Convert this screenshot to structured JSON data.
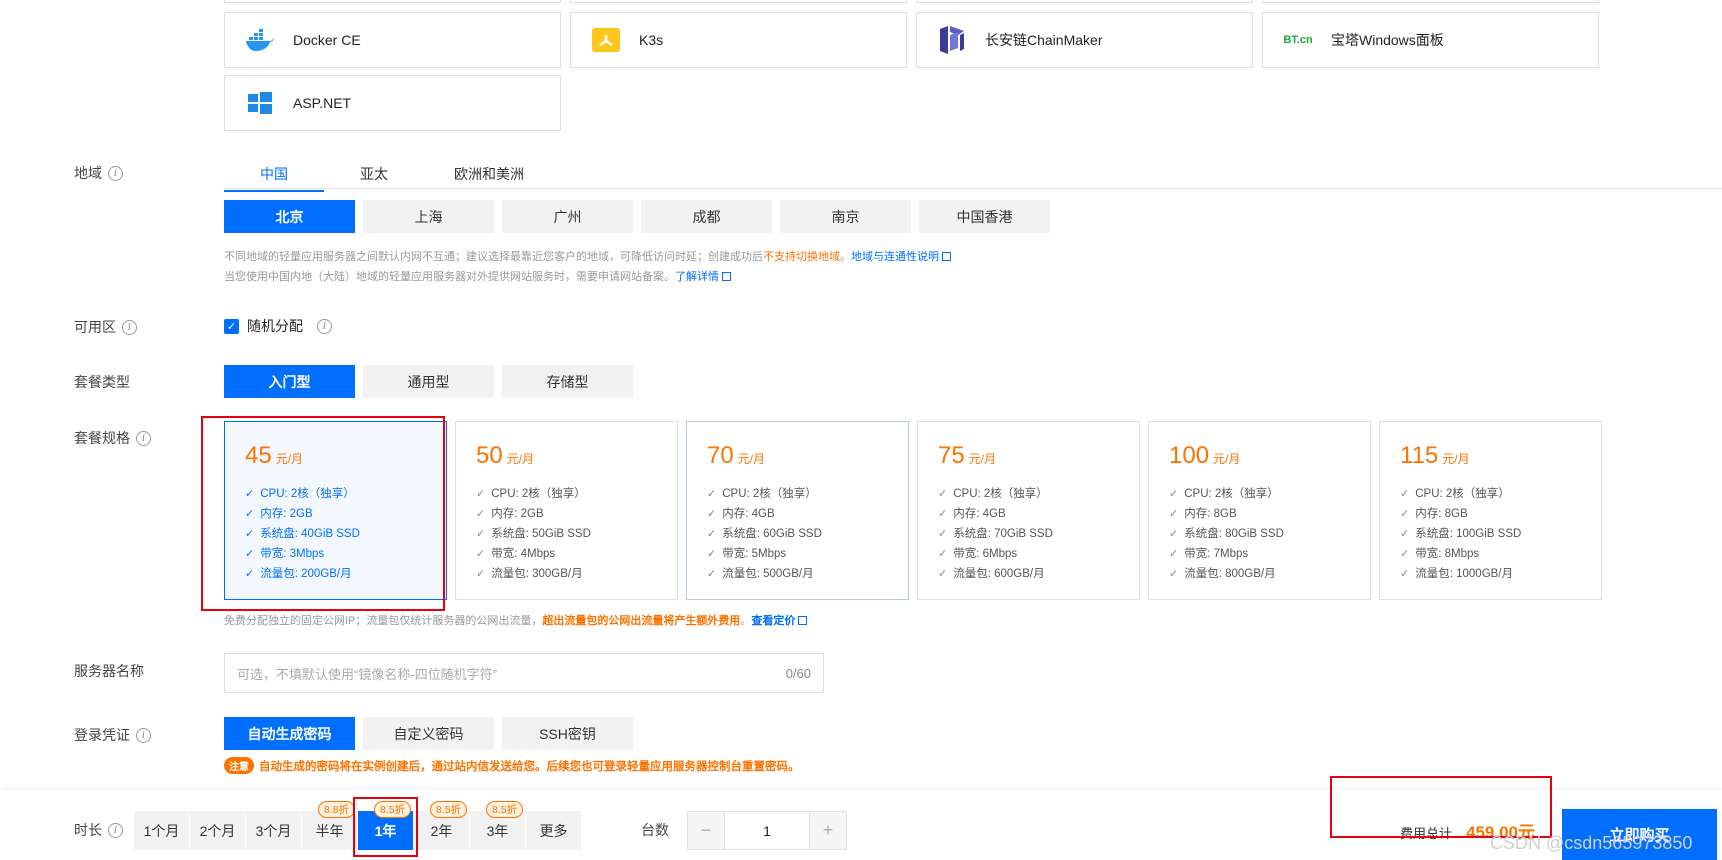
{
  "images": [
    {
      "label": "Docker CE",
      "icon": "docker-icon"
    },
    {
      "label": "K3s",
      "icon": "k3s-icon"
    },
    {
      "label": "长安链ChainMaker",
      "icon": "chainmaker-icon"
    },
    {
      "label": "宝塔Windows面板",
      "icon": "bt-panel-icon",
      "icon_text": "BT.cn"
    },
    {
      "label": "ASP.NET",
      "icon": "windows-icon"
    }
  ],
  "region": {
    "label": "地域",
    "tabs": [
      "中国",
      "亚太",
      "欧洲和美洲"
    ],
    "cities": [
      "北京",
      "上海",
      "广州",
      "成都",
      "南京",
      "中国香港"
    ],
    "note1_pre": "不同地域的轻量应用服务器之间默认内网不互通；建议选择最靠近您客户的地域，可降低访问时延；创建成功后",
    "note1_warn": "不支持切换地域",
    "note1_mid": "。",
    "note1_link": "地域与连通性说明",
    "note2_pre": "当您使用中国内地（大陆）地域的轻量应用服务器对外提供网站服务时，需要申请网站备案。",
    "note2_link": "了解详情"
  },
  "zone": {
    "label": "可用区",
    "option": "随机分配"
  },
  "package_type": {
    "label": "套餐类型",
    "options": [
      "入门型",
      "通用型",
      "存储型"
    ]
  },
  "package_spec": {
    "label": "套餐规格",
    "unit": "元/月",
    "plans": [
      {
        "price": "45",
        "cpu": "CPU: 2核（独享）",
        "mem": "内存: 2GB",
        "disk": "系统盘: 40GiB SSD",
        "bw": "带宽: 3Mbps",
        "traffic": "流量包: 200GB/月"
      },
      {
        "price": "50",
        "cpu": "CPU: 2核（独享）",
        "mem": "内存: 2GB",
        "disk": "系统盘: 50GiB SSD",
        "bw": "带宽: 4Mbps",
        "traffic": "流量包: 300GB/月"
      },
      {
        "price": "70",
        "cpu": "CPU: 2核（独享）",
        "mem": "内存: 4GB",
        "disk": "系统盘: 60GiB SSD",
        "bw": "带宽: 5Mbps",
        "traffic": "流量包: 500GB/月"
      },
      {
        "price": "75",
        "cpu": "CPU: 2核（独享）",
        "mem": "内存: 4GB",
        "disk": "系统盘: 70GiB SSD",
        "bw": "带宽: 6Mbps",
        "traffic": "流量包: 600GB/月"
      },
      {
        "price": "100",
        "cpu": "CPU: 2核（独享）",
        "mem": "内存: 8GB",
        "disk": "系统盘: 80GiB SSD",
        "bw": "带宽: 7Mbps",
        "traffic": "流量包: 800GB/月"
      },
      {
        "price": "115",
        "cpu": "CPU: 2核（独享）",
        "mem": "内存: 8GB",
        "disk": "系统盘: 100GiB SSD",
        "bw": "带宽: 8Mbps",
        "traffic": "流量包: 1000GB/月"
      }
    ],
    "note_pre": "免费分配独立的固定公网IP；流量包仅统计服务器的公网出流量，",
    "note_warn": "超出流量包的公网出流量将产生额外费用",
    "note_mid": "。",
    "note_link": "查看定价"
  },
  "server_name": {
    "label": "服务器名称",
    "placeholder": "可选，不填默认使用“镜像名称-四位随机字符”",
    "counter": "0/60"
  },
  "login": {
    "label": "登录凭证",
    "options": [
      "自动生成密码",
      "自定义密码",
      "SSH密钥"
    ],
    "notice_tag": "注意",
    "notice": "自动生成的密码将在实例创建后，通过站内信发送给您。后续您也可登录轻量应用服务器控制台重置密码。"
  },
  "duration": {
    "label": "时长",
    "options": [
      "1个月",
      "2个月",
      "3个月",
      "半年",
      "1年",
      "2年",
      "3年",
      "更多"
    ],
    "discounts": {
      "half": "8.8折",
      "y1": "8.5折",
      "y2": "8.5折",
      "y3": "8.5折"
    }
  },
  "quantity": {
    "label": "台数",
    "minus": "−",
    "value": "1",
    "plus": "+"
  },
  "total": {
    "label": "费用总计",
    "amount": "459.00元"
  },
  "buy_label": "立即购买",
  "watermark": "CSDN @csdn565973850",
  "colors": {
    "primary": "#006eff",
    "warn": "#ff7200",
    "highlight_box": "#e60012"
  }
}
